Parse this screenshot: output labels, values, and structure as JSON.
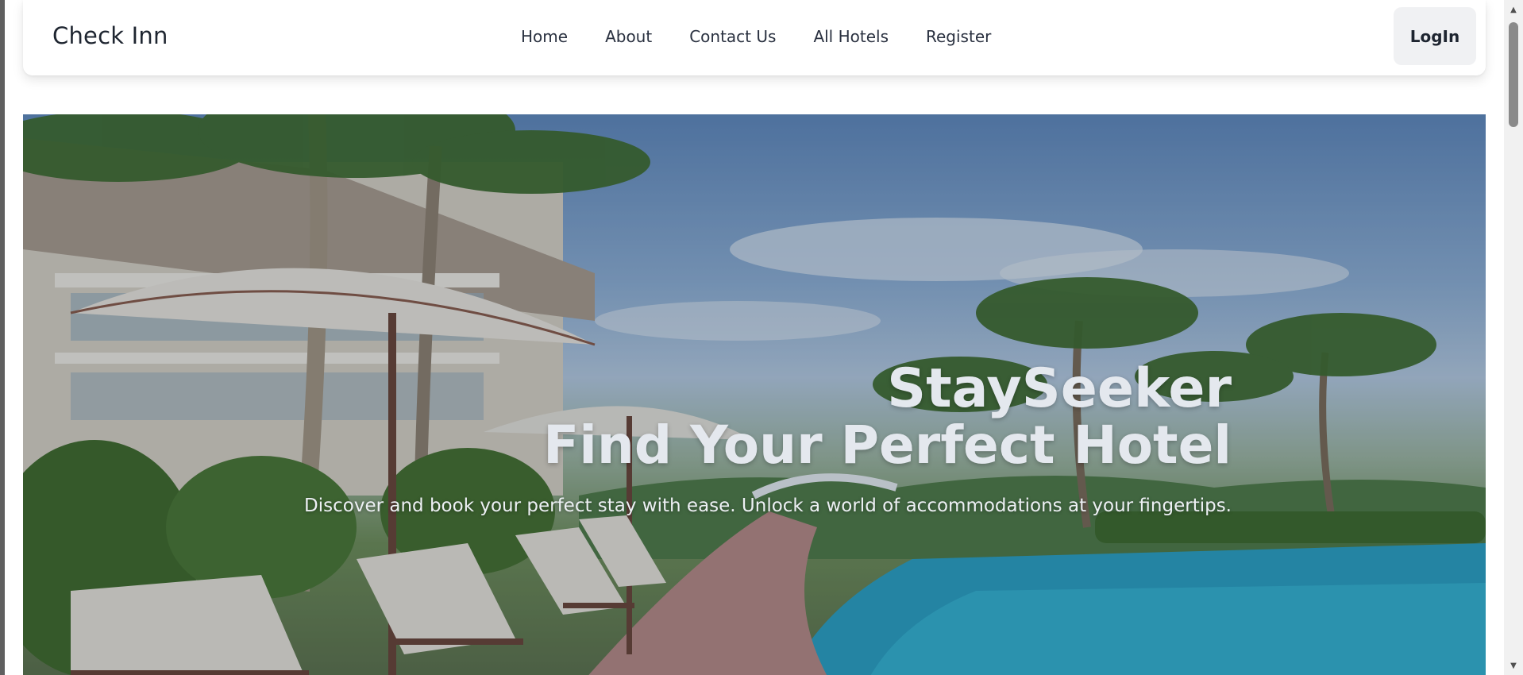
{
  "navbar": {
    "brand": "Check Inn",
    "links": [
      "Home",
      "About",
      "Contact Us",
      "All Hotels",
      "Register"
    ],
    "login_label": "LogIn"
  },
  "hero": {
    "title_line_1": "StaySeeker",
    "title_line_2": "Find Your Perfect Hotel",
    "subtitle": "Discover and book your perfect stay with ease. Unlock a world of accommodations at your fingertips.",
    "text_color": "#e4e8ee"
  },
  "scrollbar": {
    "up_icon": "chevron-up-icon",
    "down_icon": "chevron-down-icon"
  }
}
